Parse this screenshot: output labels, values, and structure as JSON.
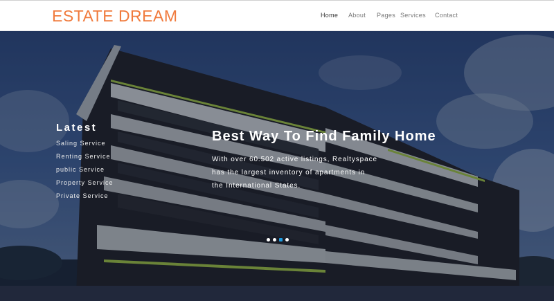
{
  "brand": {
    "logo": "ESTATE DREAM",
    "accent": "#f07a3c"
  },
  "nav": {
    "items": [
      {
        "label": "Home",
        "active": true
      },
      {
        "label": "About",
        "active": false
      },
      {
        "label": "Pages",
        "active": false
      },
      {
        "label": "Services",
        "active": false
      },
      {
        "label": "Contact",
        "active": false
      }
    ]
  },
  "sidebar": {
    "title": "Latest",
    "items": [
      {
        "label": "Saling Service"
      },
      {
        "label": "Renting Service"
      },
      {
        "label": "public Service"
      },
      {
        "label": "Property Service"
      },
      {
        "label": "Private Service"
      }
    ]
  },
  "hero": {
    "headline": "Best Way To Find Family Home",
    "description": "With over 60.502 active listings, Realtyspace has the largest inventory of apartments in the International States.",
    "slides": {
      "count": 4,
      "active_index": 2
    },
    "active_dot_color": "#1e9be0"
  }
}
